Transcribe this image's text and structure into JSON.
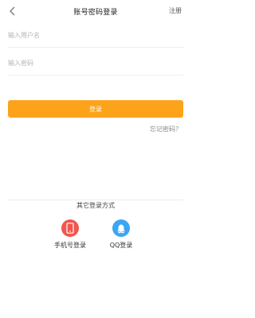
{
  "header": {
    "title": "账号密码登录",
    "register": "注册",
    "back_icon": "chevron-left-icon"
  },
  "form": {
    "username_placeholder": "输入用户名",
    "password_placeholder": "输入密码",
    "login_label": "登录",
    "forgot_label": "忘记密码？"
  },
  "other_login": {
    "title": "其它登录方式",
    "methods": [
      {
        "label": "手机号登录",
        "icon": "phone-icon",
        "color": "#f0574d"
      },
      {
        "label": "QQ登录",
        "icon": "qq-icon",
        "color": "#3ba6f3"
      }
    ]
  },
  "colors": {
    "accent": "#fda31a",
    "phone": "#f0574d",
    "qq": "#3ba6f3"
  }
}
